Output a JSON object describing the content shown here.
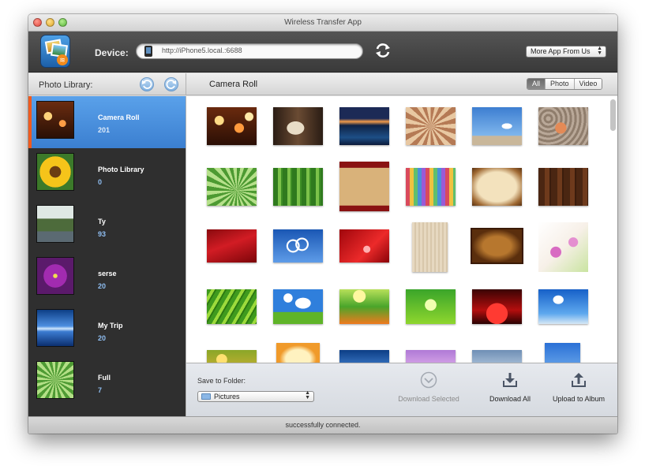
{
  "window": {
    "title": "Wireless Transfer App"
  },
  "toolbar": {
    "device_label": "Device:",
    "device_url": "http://iPhone5.local.:6688",
    "more_apps": "More App From Us",
    "refresh_icon": "refresh-arrows-icon"
  },
  "sidebar": {
    "heading": "Photo Library:",
    "albums": [
      {
        "name": "Camera Roll",
        "count": "201"
      },
      {
        "name": "Photo Library",
        "count": "0"
      },
      {
        "name": "Ty",
        "count": "93"
      },
      {
        "name": "serse",
        "count": "20"
      },
      {
        "name": "My Trip",
        "count": "20"
      },
      {
        "name": "Full",
        "count": "7"
      }
    ]
  },
  "main": {
    "title": "Camera Roll",
    "filters": [
      "All",
      "Photo",
      "Video"
    ],
    "active_filter": "All"
  },
  "bottom": {
    "save_to_folder": "Save to Folder:",
    "folder_value": "Pictures",
    "download_selected": "Download Selected",
    "download_all": "Download All",
    "upload_to_album": "Upload to Album"
  },
  "status": {
    "text": "successfully connected."
  },
  "colors": {
    "accent": "#4a90e2",
    "selection_marker": "#f05a1e",
    "sidebar_bg": "#2f2f2f"
  }
}
